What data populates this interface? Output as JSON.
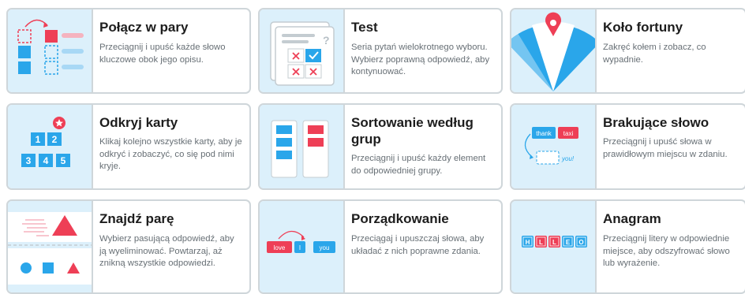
{
  "templates": [
    {
      "title": "Połącz w pary",
      "desc": "Przeciągnij i upuść każde słowo kluczowe obok jego opisu.",
      "icon": "match-up-icon"
    },
    {
      "title": "Test",
      "desc": "Seria pytań wielokrotnego wyboru. Wybierz poprawną odpowiedź, aby kontynuować.",
      "icon": "quiz-icon"
    },
    {
      "title": "Koło fortuny",
      "desc": "Zakręć kołem i zobacz, co wypadnie.",
      "icon": "wheel-icon"
    },
    {
      "title": "Odkryj karty",
      "desc": "Klikaj kolejno wszystkie karty, aby je odkryć i zobaczyć, co się pod nimi kryje.",
      "icon": "open-box-icon"
    },
    {
      "title": "Sortowanie według grup",
      "desc": "Przeciągnij i upuść każdy element do odpowiedniej grupy.",
      "icon": "group-sort-icon"
    },
    {
      "title": "Brakujące słowo",
      "desc": "Przeciągnij i upuść słowa w prawidłowym miejscu w zdaniu.",
      "icon": "missing-word-icon"
    },
    {
      "title": "Znajdź parę",
      "desc": "Wybierz pasującą odpowiedź, aby ją wyeliminować. Powtarzaj, aż znikną wszystkie odpowiedzi.",
      "icon": "find-match-icon"
    },
    {
      "title": "Porządkowanie",
      "desc": "Przeciągaj i upuszczaj słowa, aby układać z nich poprawne zdania.",
      "icon": "unjumble-icon"
    },
    {
      "title": "Anagram",
      "desc": "Przeciągnij litery w odpowiednie miejsce, aby odszyfrować słowo lub wyrażenie.",
      "icon": "anagram-icon"
    }
  ],
  "thumb_text": {
    "quiz_mark": "?",
    "box_numbers": [
      "1",
      "2",
      "3",
      "4",
      "5"
    ],
    "missing_chips": [
      "thank",
      "taxi"
    ],
    "missing_blank": "you!",
    "unjumble_words": [
      "love",
      "I",
      "you"
    ],
    "anagram_letters": [
      "H",
      "L",
      "L",
      "E",
      "O"
    ]
  },
  "colors": {
    "thumb_bg": "#dcf0fb",
    "blue": "#2aa6ea",
    "red": "#ee3f56",
    "border": "#cfd6da"
  }
}
